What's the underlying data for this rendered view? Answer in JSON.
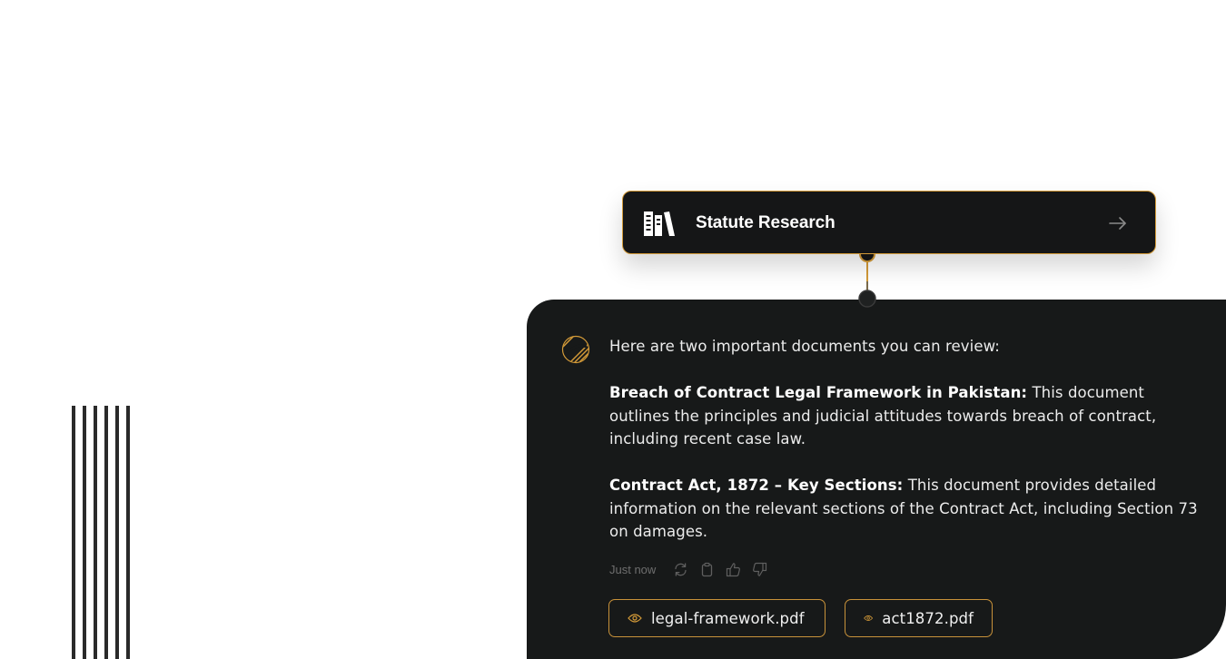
{
  "tool_card": {
    "title": "Statute Research",
    "icon": "library-books-icon",
    "arrow_icon": "arrow-right-icon",
    "accent_color": "#d39a38"
  },
  "assistant": {
    "avatar_icon": "hatched-sphere-icon",
    "intro": "Here are two important documents you can review:",
    "documents": [
      {
        "title": "Breach of Contract Legal Framework in Pakistan:",
        "description": " This document outlines the principles and judicial attitudes towards breach of contract, including recent case law."
      },
      {
        "title": "Contract Act, 1872 – Key Sections:",
        "description": " This document provides detailed information on the relevant sections of the Contract Act, including Section 73 on damages."
      }
    ],
    "timestamp": "Just now",
    "actions": [
      "regenerate-icon",
      "copy-icon",
      "thumbs-up-icon",
      "thumbs-down-icon"
    ],
    "files": [
      {
        "name": "legal-framework.pdf",
        "icon": "eye-icon"
      },
      {
        "name": "act1872.pdf",
        "icon": "eye-icon"
      }
    ]
  },
  "colors": {
    "panel_background": "#171919",
    "accent": "#d39a38",
    "text": "#ececec",
    "muted": "#6e6e6e"
  }
}
